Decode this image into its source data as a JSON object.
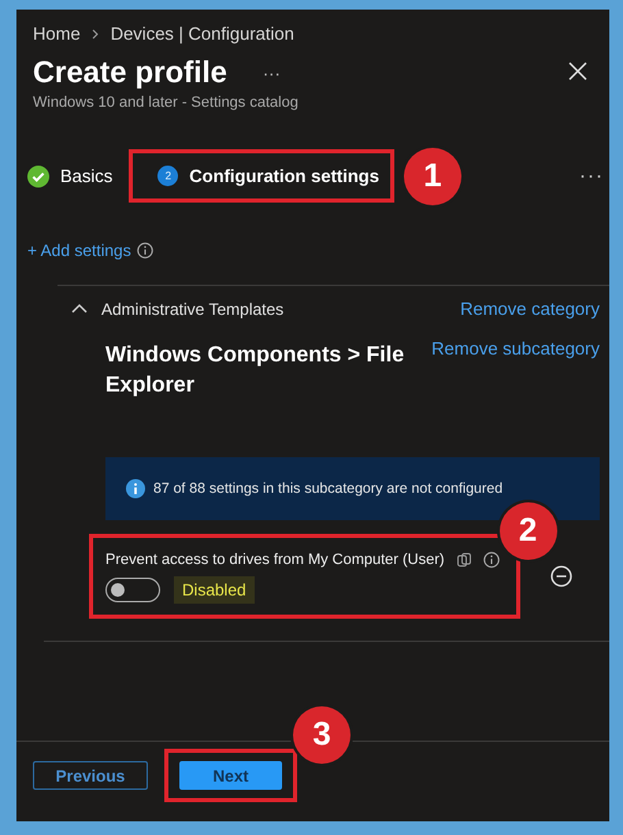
{
  "breadcrumb": [
    "Home",
    "Devices | Configuration"
  ],
  "header": {
    "title": "Create profile",
    "more": "···",
    "subtitle": "Windows 10 and later - Settings catalog"
  },
  "steps": [
    {
      "label": "Basics",
      "completed": true,
      "selected": false
    },
    {
      "label": "Configuration settings",
      "completed": false,
      "selected": true,
      "number": "2",
      "callout": "1"
    }
  ],
  "steps_more": "···",
  "add_settings": "+ Add settings",
  "category": {
    "title": "Administrative Templates",
    "expanded": true,
    "remove_label": "Remove category",
    "subcategory": {
      "title": "Windows Components > File Explorer",
      "remove_label": "Remove subcategory",
      "banner": "87 of 88 settings in this subcategory are not configured",
      "settings": [
        {
          "label": "Prevent access to drives from My Computer (User)",
          "on": false,
          "value_text": "Disabled",
          "callout": "2"
        }
      ]
    }
  },
  "buttons": [
    {
      "label": "Previous",
      "primary": false
    },
    {
      "label": "Next",
      "primary": true,
      "callout": "3"
    }
  ]
}
